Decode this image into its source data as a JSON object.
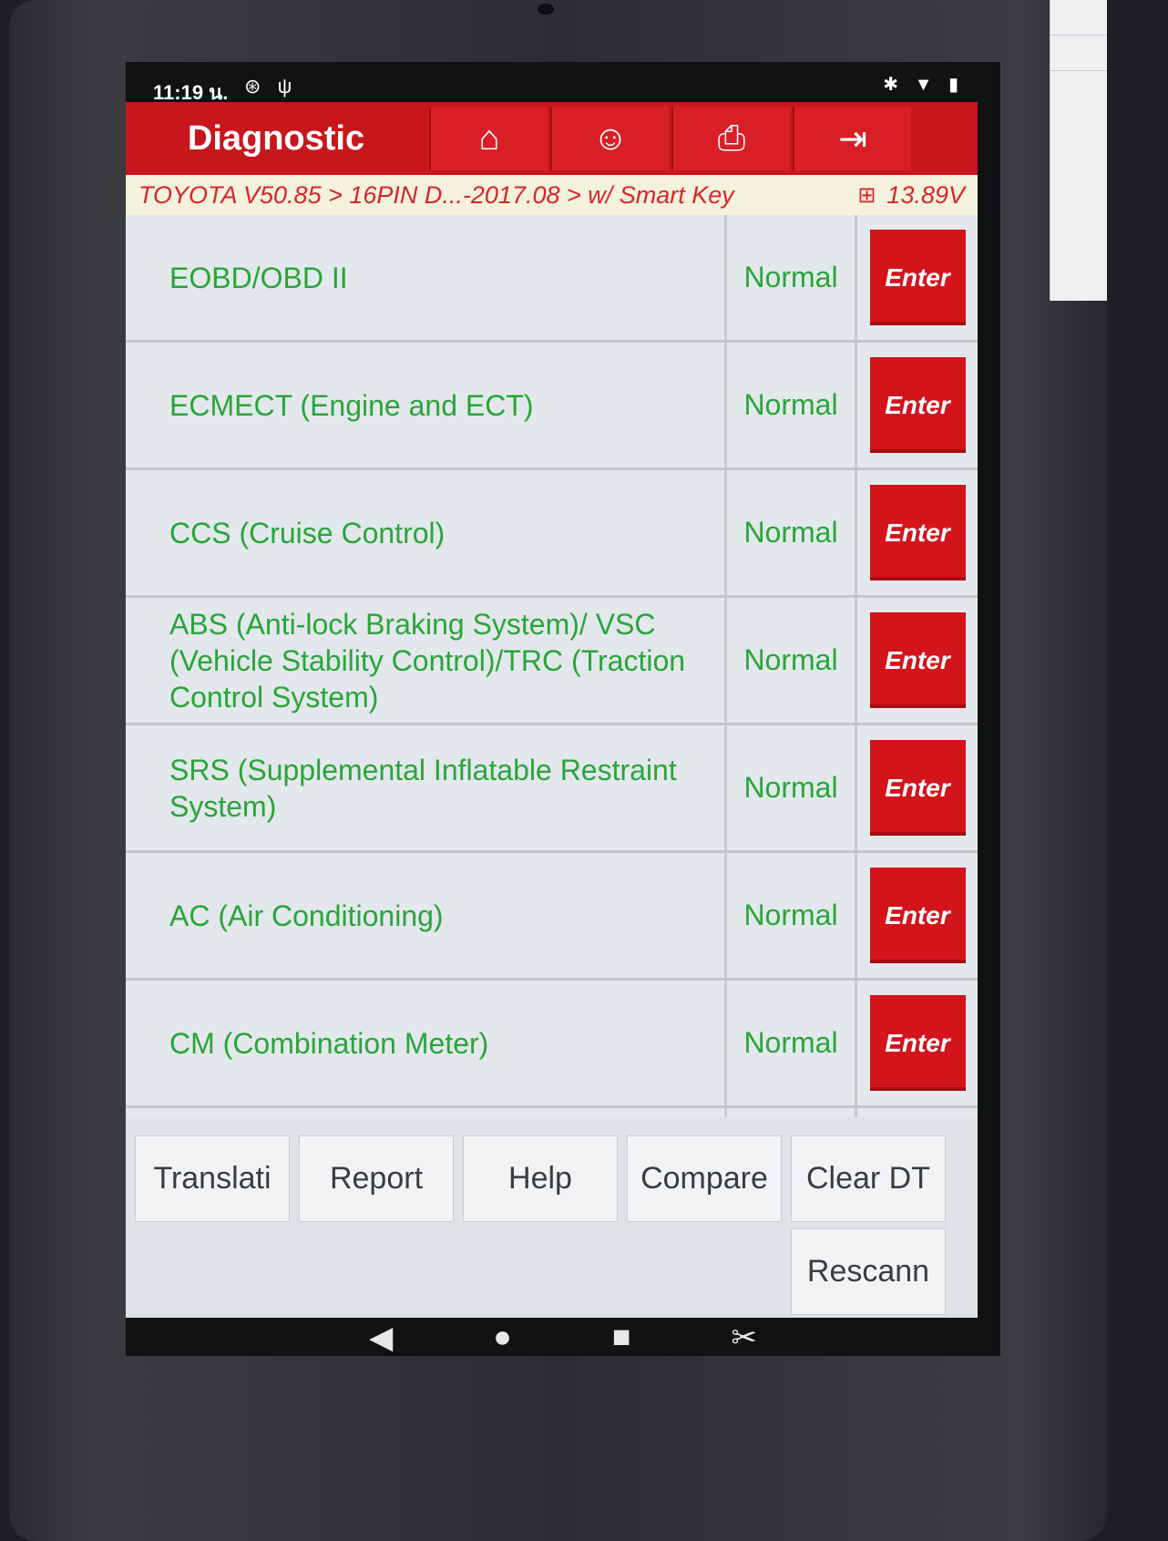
{
  "status_bar": {
    "time": "11:19 น.",
    "left_icons": [
      "settings-circle-icon",
      "network-icon"
    ],
    "right_icons": [
      "bluetooth-icon",
      "wifi-icon",
      "battery-icon"
    ]
  },
  "header": {
    "title": "Diagnostic",
    "buttons": [
      "home-icon",
      "support-person-icon",
      "printer-icon",
      "exit-icon"
    ],
    "accent_color": "#c8161d"
  },
  "breadcrumb": {
    "path": "TOYOTA V50.85 > 16PIN D...-2017.08 > w/ Smart Key",
    "battery_icon": "battery-icon",
    "voltage": "13.89V"
  },
  "systems": [
    {
      "name": "EOBD/OBD II",
      "status": "Normal",
      "action": "Enter"
    },
    {
      "name": "ECMECT (Engine and ECT)",
      "status": "Normal",
      "action": "Enter"
    },
    {
      "name": "CCS (Cruise Control)",
      "status": "Normal",
      "action": "Enter"
    },
    {
      "name": "ABS (Anti-lock Braking System)/ VSC (Vehicle Stability Control)/TRC (Traction Control System)",
      "status": "Normal",
      "action": "Enter"
    },
    {
      "name": "SRS (Supplemental Inflatable Restraint System)",
      "status": "Normal",
      "action": "Enter"
    },
    {
      "name": "AC (Air Conditioning)",
      "status": "Normal",
      "action": "Enter"
    },
    {
      "name": "CM (Combination Meter)",
      "status": "Normal",
      "action": "Enter"
    }
  ],
  "footer": {
    "translation": "Translati",
    "report": "Report",
    "help": "Help",
    "compare": "Compare",
    "clear_dtc": "Clear DT",
    "rescan": "Rescann"
  },
  "nav": [
    "back-icon",
    "home-dot-icon",
    "recents-square-icon",
    "screenshot-icon"
  ],
  "colors": {
    "status_green": "#2aa53a",
    "enter_red": "#d3141b"
  }
}
